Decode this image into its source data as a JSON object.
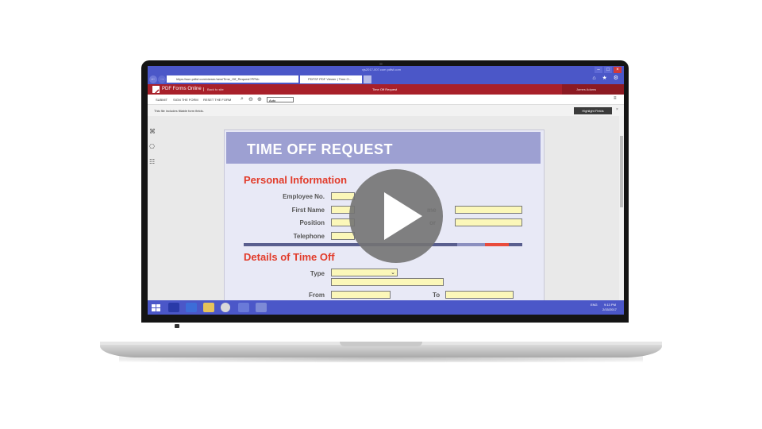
{
  "browser": {
    "window_title": "xjs2017-007.com  pdfsf.com",
    "url": "https://sun.pdfsf.com/viewer/new/Time_Off_Request?PPhb",
    "tab_label": "PDFSF PDF Viewer | Time O...",
    "window_controls": [
      "–",
      "□",
      "×"
    ],
    "nav_back": "←",
    "nav_forward": "→",
    "right_icons": "⌂ ★ ⚙"
  },
  "app_header": {
    "logo_text": "PDF Forms Online",
    "back_link": "Back to site",
    "title": "Time Off Request",
    "user": "James Adams"
  },
  "toolbar": {
    "submit": "SUBMIT",
    "sign": "SIGN THE FORM",
    "reset": "RESET THE FORM",
    "zoom_select": "Auto",
    "menu_icon": "≡"
  },
  "infobar": {
    "message": "This file includes fillable form fields.",
    "highlight_button": "Highlight Fields",
    "close": "×"
  },
  "form": {
    "title": "TIME OFF REQUEST",
    "section1": "Personal Information",
    "labels1": [
      "Employee No.",
      "First Name",
      "Position",
      "Telephone"
    ],
    "right_labels1": [
      "me",
      "or"
    ],
    "section2": "Details of Time Off",
    "type_label": "Type",
    "from_label": "From",
    "to_label": "To"
  },
  "taskbar": {
    "tray_lang": "ENG",
    "time": "9:13 PM",
    "date": "2/15/2017"
  },
  "colors": {
    "titlebar": "#4b57c8",
    "app_header": "#a8202a",
    "form_header": "#9da0d2",
    "section_red": "#e23b2a",
    "field_yellow": "#fbf7b9"
  }
}
